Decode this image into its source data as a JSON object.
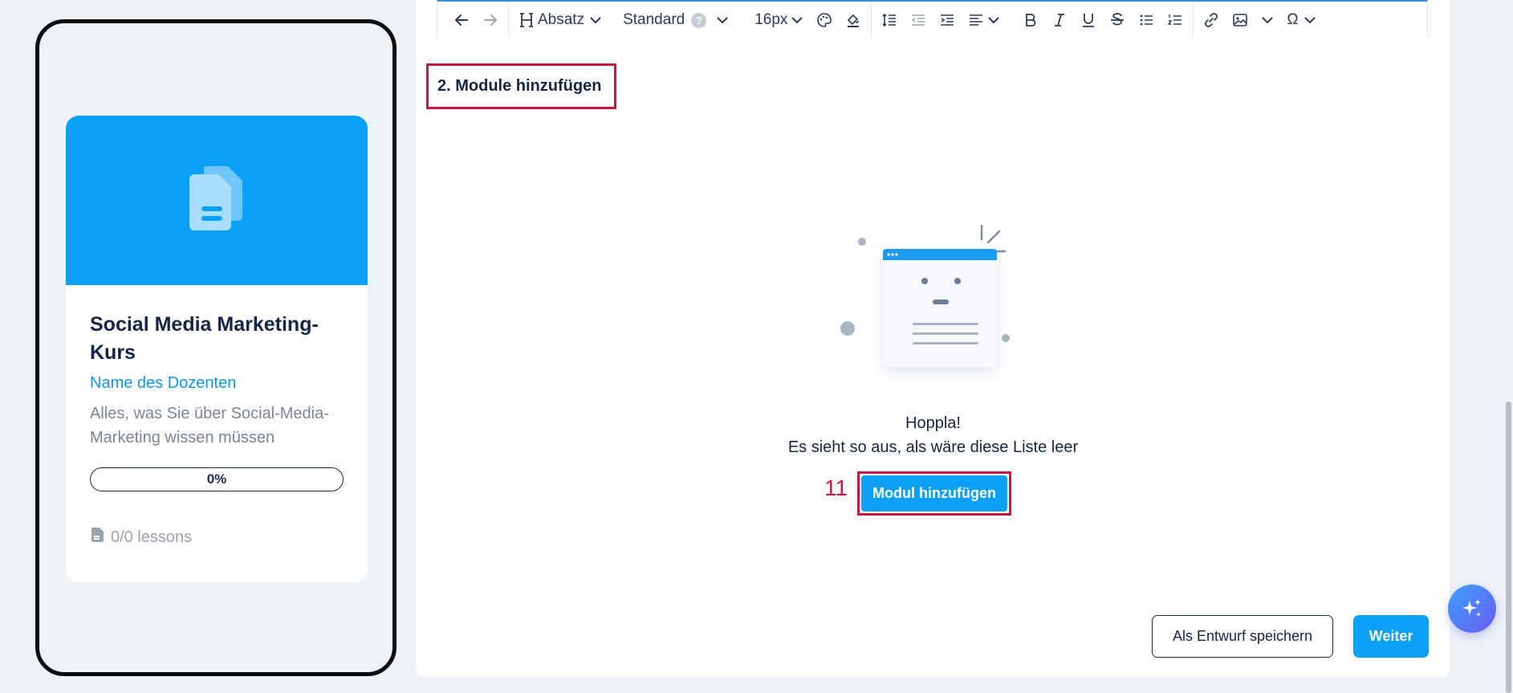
{
  "preview_card": {
    "title": "Social Media Marketing-Kurs",
    "instructor": "Name des Dozenten",
    "description": "Alles, was Sie über Social-Media-Marketing wissen müssen",
    "progress_label": "0%",
    "progress_value": 0,
    "lessons": "0/0 lessons",
    "hero_icon": "documents-icon",
    "hero_color": "#0aa0f5"
  },
  "toolbar": {
    "heading_label": "Absatz",
    "font_label": "Standard",
    "font_help": "?",
    "size_label": "16px",
    "special_char": "Ω"
  },
  "section": {
    "heading": "2. Module hinzufügen"
  },
  "empty_state": {
    "title": "Hoppla!",
    "subtitle": "Es sieht so aus, als wäre diese Liste leer",
    "step_number": "11",
    "add_button": "Modul hinzufügen"
  },
  "footer": {
    "draft_button": "Als Entwurf speichern",
    "next_button": "Weiter"
  },
  "colors": {
    "accent": "#0aa0f5",
    "highlight": "#c8173f",
    "text": "#142545"
  }
}
